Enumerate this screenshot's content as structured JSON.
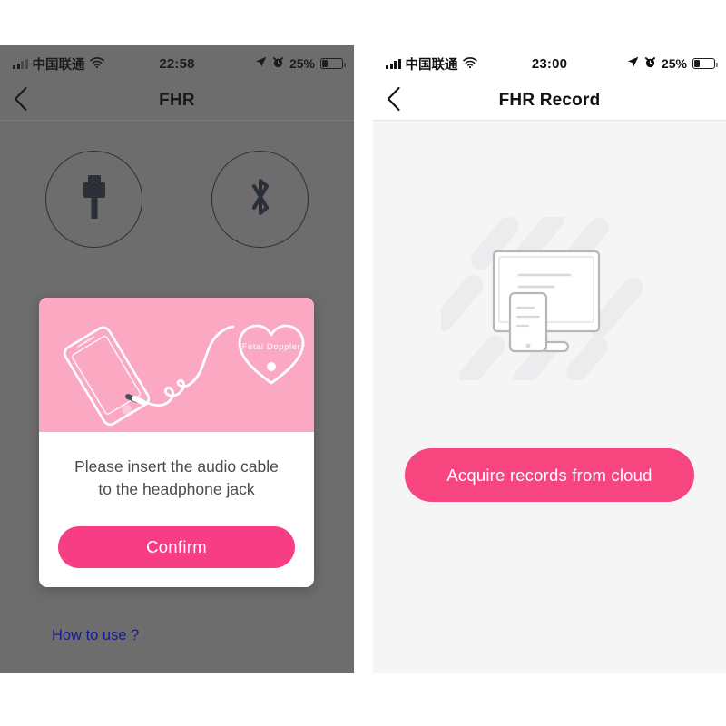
{
  "screens": [
    {
      "id": "fhr-connect",
      "statusbar": {
        "carrier": "中国联通",
        "time": "22:58",
        "battery_pct": "25%",
        "signal_icon": "signal-bars-icon",
        "wifi_icon": "wifi-icon",
        "location_icon": "location-arrow-icon",
        "alarm_icon": "alarm-clock-icon",
        "battery_icon": "battery-icon"
      },
      "navbar": {
        "title": "FHR",
        "back_icon": "back-chevron-icon"
      },
      "devices": [
        {
          "icon": "audio-jack-plug-icon",
          "name": "audio-jack-device-button"
        },
        {
          "icon": "bluetooth-icon",
          "name": "bluetooth-device-button"
        }
      ],
      "how_to_use": "How to use ?",
      "dialog": {
        "illustration": {
          "phone_icon": "smartphone-outline-icon",
          "cable_icon": "audio-cable-icon",
          "device_icon": "heart-doppler-icon",
          "device_label": "Fetal Doppler"
        },
        "message_line1": "Please insert the audio cable",
        "message_line2": "to the headphone jack",
        "confirm_label": "Confirm"
      }
    },
    {
      "id": "fhr-record",
      "statusbar": {
        "carrier": "中国联通",
        "time": "23:00",
        "battery_pct": "25%",
        "signal_icon": "signal-bars-icon",
        "wifi_icon": "wifi-icon",
        "location_icon": "location-arrow-icon",
        "alarm_icon": "alarm-clock-icon",
        "battery_icon": "battery-icon"
      },
      "navbar": {
        "title": "FHR Record",
        "back_icon": "back-chevron-icon"
      },
      "empty_state": {
        "illustration_icon": "monitor-and-phone-empty-state-icon"
      },
      "acquire_label": "Acquire records from cloud"
    }
  ],
  "colors": {
    "dim_overlay": "#6d6d6d",
    "dialog_art_pink": "#fba8c3",
    "primary_pink": "#f7467f",
    "confirm_pink": "#f73e85",
    "link_navy": "#1b1b8f",
    "page_bg": "#f5f5f5"
  }
}
